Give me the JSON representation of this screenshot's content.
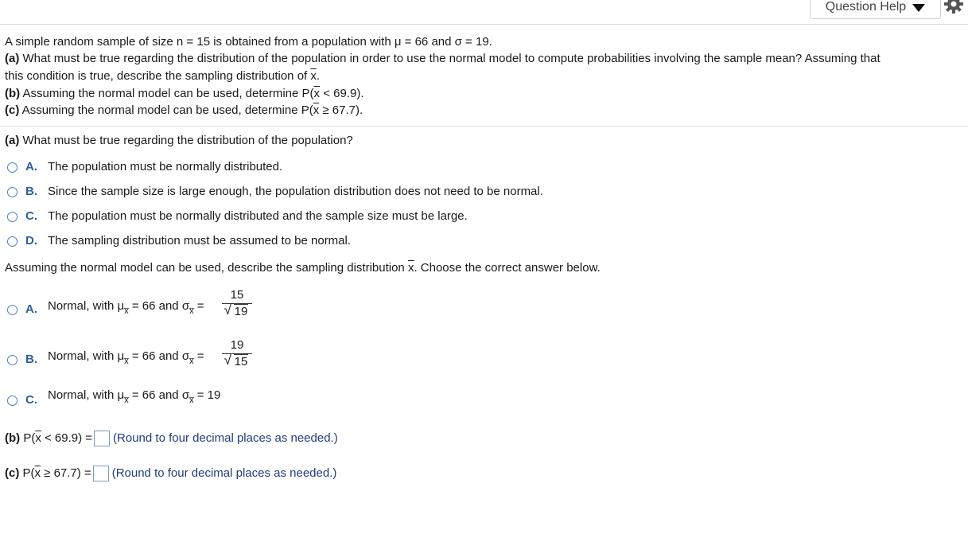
{
  "header": {
    "help_label": "Question Help"
  },
  "problem": {
    "intro": "A simple random sample of size n = 15 is obtained from a population with μ = 66 and σ = 19.",
    "part_a_label": "(a)",
    "part_a_text": " What must be true regarding the distribution of the population in order to use the normal model to compute probabilities involving the sample mean? Assuming that",
    "part_a_cont_prefix": "this condition is true, describe the sampling distribution of ",
    "part_a_cont_x": "x",
    "part_a_cont_suffix": ".",
    "part_b_label": "(b)",
    "part_b_text_pre": " Assuming the normal model can be used, determine P(",
    "part_b_x": "x",
    "part_b_text_post": " < 69.9).",
    "part_c_label": "(c)",
    "part_c_text_pre": " Assuming the normal model can be used, determine P(",
    "part_c_x": "x",
    "part_c_text_post": " ≥ 67.7)."
  },
  "question_a": {
    "label": "(a)",
    "text": " What must be true regarding the distribution of the population?",
    "options": [
      {
        "letter": "A.",
        "text": "The population must be normally distributed."
      },
      {
        "letter": "B.",
        "text": "Since the sample size is large enough, the population distribution does not need to be normal."
      },
      {
        "letter": "C.",
        "text": "The population must be normally distributed and the sample size must be large."
      },
      {
        "letter": "D.",
        "text": "The sampling distribution must be assumed to be normal."
      }
    ]
  },
  "question_dist": {
    "prompt_pre": "Assuming the normal model can be used, describe the sampling distribution ",
    "prompt_x": "x",
    "prompt_post": ". Choose the correct answer below.",
    "options": [
      {
        "letter": "A.",
        "text_pre": "Normal, with μ",
        "sub": "x̅",
        "mid": " = 66 and σ",
        "sub2": "x̅",
        "eq": " =",
        "num": "15",
        "den": "19"
      },
      {
        "letter": "B.",
        "text_pre": "Normal, with μ",
        "sub": "x̅",
        "mid": " = 66 and σ",
        "sub2": "x̅",
        "eq": " =",
        "num": "19",
        "den": "15"
      },
      {
        "letter": "C.",
        "text_pre": "Normal, with μ",
        "sub": "x̅",
        "mid": " = 66 and σ",
        "sub2": "x̅",
        "eq": " = 19"
      }
    ]
  },
  "answer_b": {
    "label": "(b)",
    "pre": " P(",
    "x": "x",
    "post": " < 69.9) =",
    "note": "(Round to four decimal places as needed.)"
  },
  "answer_c": {
    "label": "(c)",
    "pre": " P(",
    "x": "x",
    "post": " ≥ 67.7) =",
    "note": "(Round to four decimal places as needed.)"
  }
}
